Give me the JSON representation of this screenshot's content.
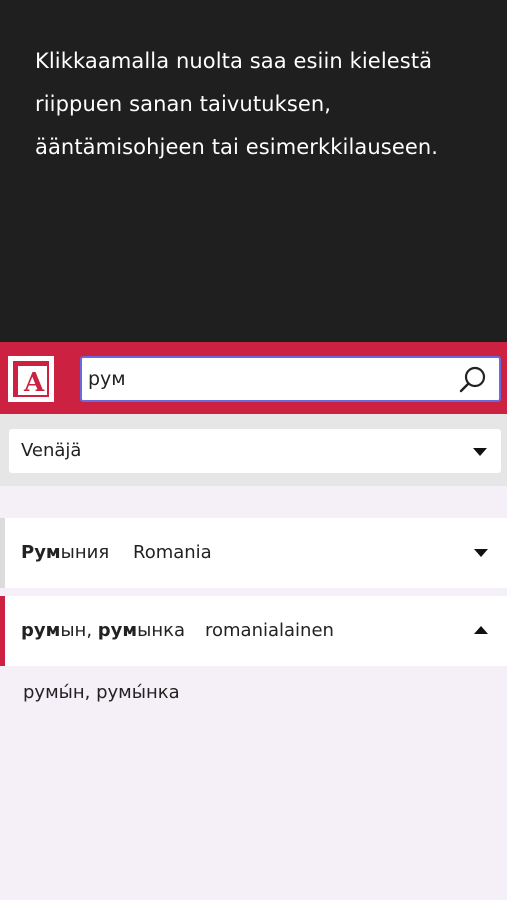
{
  "tip": {
    "text": "Klikkaamalla nuolta saa esiin kielestä riippuen sanan taivutuksen, ääntämisohjeen tai esimerkkilauseen."
  },
  "header": {
    "logo_letter": "A",
    "search": {
      "value": "рум",
      "icon": "search-icon"
    },
    "accent_color": "#cc2140"
  },
  "language": {
    "selected": "Venäjä",
    "icon": "chevron-down-icon"
  },
  "results": [
    {
      "word_bold": "Рум",
      "word_rest": "ыния",
      "translation": "Romania",
      "expanded": false,
      "icon": "chevron-down-icon"
    },
    {
      "word_bold_1": "рум",
      "word_rest_1": "ын, ",
      "word_bold_2": "рум",
      "word_rest_2": "ынка",
      "translation": "romanialainen",
      "expanded": true,
      "icon": "chevron-up-icon",
      "detail": "румы́н, румы́нка"
    }
  ]
}
